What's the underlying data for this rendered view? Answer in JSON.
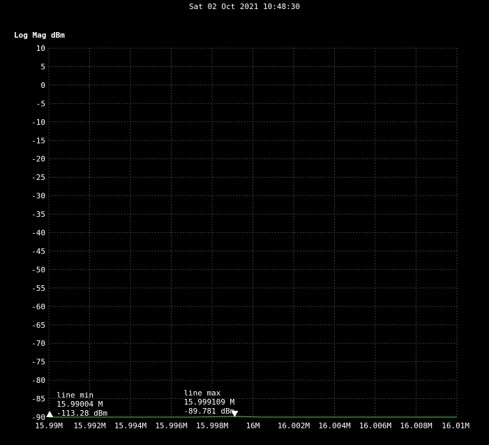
{
  "header": {
    "timestamp": "Sat 02 Oct 2021 10:48:30"
  },
  "colors": {
    "background": "#000000",
    "grid": "#3c3c3c",
    "trace": "#33aa33",
    "text": "#ffffff"
  },
  "chart_data": {
    "type": "line",
    "title": "",
    "ylabel": "Log Mag dBm",
    "xlabel": "",
    "grid": true,
    "ylim": [
      -90,
      10
    ],
    "xlim": [
      15.99,
      16.01
    ],
    "x_unit": "MHz",
    "y_ticks": [
      10,
      5,
      0,
      -5,
      -10,
      -15,
      -20,
      -25,
      -30,
      -35,
      -40,
      -45,
      -50,
      -55,
      -60,
      -65,
      -70,
      -75,
      -80,
      -85,
      -90
    ],
    "x_ticks": [
      {
        "value": 15.99,
        "label": "15.99M"
      },
      {
        "value": 15.992,
        "label": "15.992M"
      },
      {
        "value": 15.994,
        "label": "15.994M"
      },
      {
        "value": 15.996,
        "label": "15.996M"
      },
      {
        "value": 15.998,
        "label": "15.998M"
      },
      {
        "value": 16.0,
        "label": "16M"
      },
      {
        "value": 16.002,
        "label": "16.002M"
      },
      {
        "value": 16.004,
        "label": "16.004M"
      },
      {
        "value": 16.006,
        "label": "16.006M"
      },
      {
        "value": 16.008,
        "label": "16.008M"
      },
      {
        "value": 16.01,
        "label": "16.01M"
      }
    ],
    "series": [
      {
        "x": [
          15.99,
          15.99004,
          15.9915,
          15.993,
          15.995,
          15.997,
          15.999109,
          16.0005,
          16.002,
          16.004,
          16.006,
          16.008,
          16.01
        ],
        "values": [
          -90.0,
          -90.0,
          -90.0,
          -90.0,
          -90.0,
          -90.0,
          -89.8,
          -90.0,
          -90.0,
          -90.0,
          -90.0,
          -90.0,
          -90.0
        ]
      }
    ],
    "markers": [
      {
        "name": "line min",
        "freq_label": "15.99004 M",
        "level_label": "-113.28 dBm",
        "x": 15.99004,
        "y": -90,
        "direction": "up"
      },
      {
        "name": "line max",
        "freq_label": "15.999109 M",
        "level_label": "-89.781 dBm",
        "x": 15.999109,
        "y": -90,
        "direction": "down"
      }
    ]
  }
}
